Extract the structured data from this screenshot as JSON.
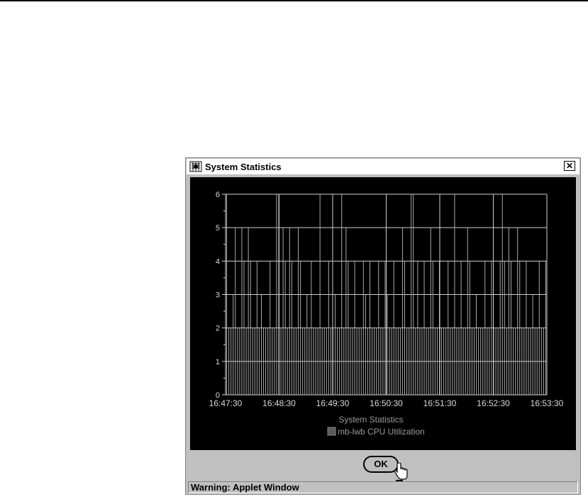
{
  "window": {
    "title": "System Statistics",
    "close_label": "✕",
    "ok_label": "OK",
    "status_text": "Warning: Applet Window"
  },
  "icons": {
    "app": "applet-window-icon",
    "close": "close-icon",
    "cursor": "hand-pointer-icon"
  },
  "chart_data": {
    "type": "bar",
    "title": "System Statistics",
    "legend": [
      {
        "name": "mb-lwb CPU Utilization",
        "color": "#5a5a5a"
      }
    ],
    "legend_placement": "bottom-center",
    "xlabel": "",
    "ylabel": "",
    "x_tick_labels": [
      "16:47:30",
      "16:48:30",
      "16:49:30",
      "16:50:30",
      "16:51:30",
      "16:52:30",
      "16:53:30"
    ],
    "y_tick_labels": [
      "0",
      "1",
      "2",
      "3",
      "4",
      "5",
      "6"
    ],
    "ylim": [
      0,
      6
    ],
    "grid": true,
    "series": [
      {
        "name": "mb-lwb CPU Utilization",
        "values": [
          6,
          2,
          2,
          3,
          5,
          2,
          2,
          5,
          4,
          2,
          5,
          4,
          2,
          2,
          4,
          2,
          3,
          2,
          2,
          2,
          4,
          2,
          2,
          6,
          6,
          2,
          5,
          4,
          2,
          5,
          4,
          2,
          2,
          5,
          4,
          2,
          2,
          3,
          2,
          4,
          2,
          2,
          2,
          6,
          2,
          2,
          2,
          4,
          2,
          2,
          3,
          2,
          2,
          6,
          2,
          5,
          4,
          2,
          2,
          4,
          2,
          2,
          2,
          4,
          3,
          2,
          4,
          2,
          2,
          2,
          4,
          2,
          2,
          4,
          3,
          2,
          2,
          4,
          2,
          2,
          2,
          5,
          4,
          2,
          2,
          6,
          6,
          2,
          4,
          2,
          2,
          4,
          2,
          2,
          5,
          4,
          2,
          2,
          4,
          2,
          2,
          2,
          4,
          2,
          2,
          6,
          2,
          2,
          4,
          2,
          2,
          5,
          4,
          2,
          2,
          3,
          2,
          2,
          2,
          4,
          2,
          2,
          4,
          2,
          2,
          2,
          4,
          6,
          4,
          2,
          5,
          4,
          2,
          2,
          5,
          4,
          2,
          2,
          4,
          2,
          2,
          3,
          2,
          2,
          4,
          2,
          2,
          4
        ]
      }
    ]
  }
}
